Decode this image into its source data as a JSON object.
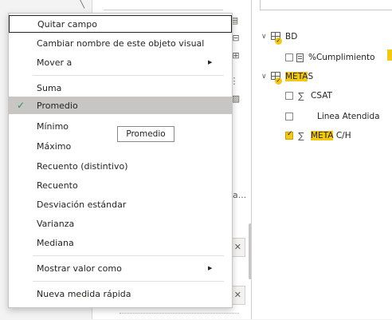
{
  "fields_pane": {
    "tables": [
      {
        "name": "BD",
        "fields": [
          {
            "label": "%Cumplimiento",
            "checked": false
          }
        ]
      },
      {
        "name_prefix": "META",
        "name_suffix": "S",
        "fields": [
          {
            "label": "CSAT",
            "checked": false
          },
          {
            "label": "Linea Atendida",
            "checked": false
          },
          {
            "label_highlight": "META",
            "label_rest": " C/H",
            "checked": true
          }
        ]
      }
    ]
  },
  "mid_pane": {
    "ellipsis": "a..."
  },
  "context_menu": {
    "items": [
      {
        "label": "Quitar campo",
        "focused": true
      },
      {
        "label": "Cambiar nombre de este objeto visual"
      },
      {
        "label": "Mover a",
        "submenu": true
      },
      {
        "label": "Suma"
      },
      {
        "label": "Promedio",
        "selected": true,
        "checked": true
      },
      {
        "label": "Mínimo"
      },
      {
        "label": "Máximo"
      },
      {
        "label": "Recuento (distintivo)"
      },
      {
        "label": "Recuento"
      },
      {
        "label": "Desviación estándar"
      },
      {
        "label": "Varianza"
      },
      {
        "label": "Mediana"
      },
      {
        "label": "Mostrar valor como",
        "submenu": true
      },
      {
        "label": "Nueva medida rápida"
      }
    ],
    "tooltip": "Promedio"
  },
  "colors": {
    "highlight": "#f2c811",
    "selected_bg": "#c8c6c4",
    "check": "#2e8b57"
  }
}
